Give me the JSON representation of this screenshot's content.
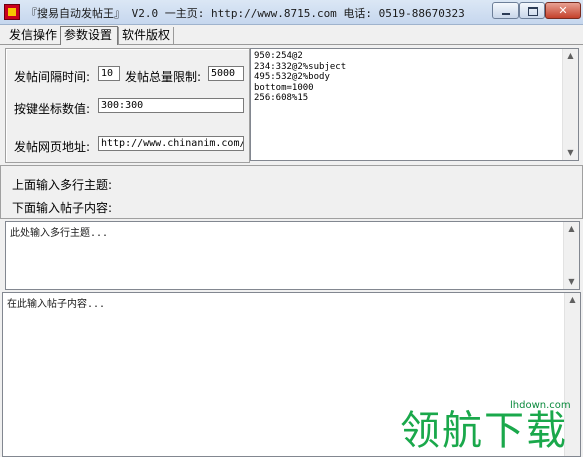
{
  "window": {
    "title": "『搜易自动发帖王』 V2.0  一主页: http://www.8715.com 电话: 0519-88670323"
  },
  "tabs": [
    {
      "label": "发信操作"
    },
    {
      "label": "参数设置"
    },
    {
      "label": "软件版权"
    }
  ],
  "params": {
    "interval_label": "发帖间隔时间:",
    "interval_value": "10",
    "total_label": "发帖总量限制:",
    "total_value": "5000",
    "key_coord_label": "按键坐标数值:",
    "key_coord_value": "300:300",
    "url_label": "发帖网页地址:",
    "url_value": "http://www.chinanim.com/bb"
  },
  "coords": {
    "text": "950:254@2\n234:332@2%subject\n495:532@2%body\nbottom=1000\n256:608%15"
  },
  "info": {
    "line1": "上面输入多行主题:",
    "line2": "下面输入帖子内容:"
  },
  "subject_area": {
    "text": "此处输入多行主题..."
  },
  "content_area": {
    "text": "在此输入帖子内容..."
  },
  "watermark": {
    "chars": "领航下载",
    "url": "lhdown.com"
  }
}
